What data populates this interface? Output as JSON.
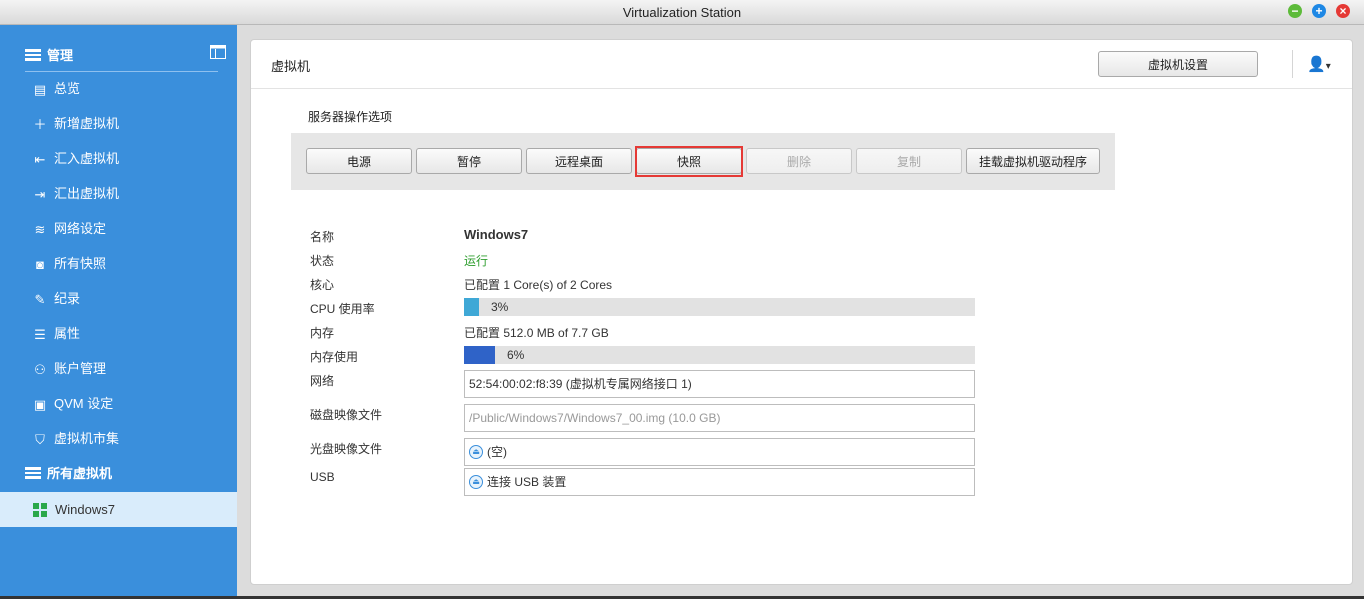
{
  "window": {
    "title": "Virtualization Station"
  },
  "sidebar": {
    "header": "管理",
    "items": [
      {
        "label": "总览",
        "icon": "overview-icon"
      },
      {
        "label": "新增虚拟机",
        "icon": "plus-icon"
      },
      {
        "label": "汇入虚拟机",
        "icon": "import-icon"
      },
      {
        "label": "汇出虚拟机",
        "icon": "export-icon"
      },
      {
        "label": "网络设定",
        "icon": "network-icon"
      },
      {
        "label": "所有快照",
        "icon": "camera-icon"
      },
      {
        "label": "纪录",
        "icon": "log-icon"
      },
      {
        "label": "属性",
        "icon": "list-icon"
      },
      {
        "label": "账户管理",
        "icon": "users-icon"
      },
      {
        "label": "QVM 设定",
        "icon": "settings-icon"
      },
      {
        "label": "虚拟机市集",
        "icon": "market-icon"
      }
    ],
    "section": "所有虚拟机",
    "vm": "Windows7"
  },
  "panel": {
    "title": "虚拟机",
    "settings_button": "虚拟机设置",
    "ops_title": "服务器操作选项",
    "buttons": [
      {
        "label": "电源",
        "enabled": true
      },
      {
        "label": "暂停",
        "enabled": true
      },
      {
        "label": "远程桌面",
        "enabled": true
      },
      {
        "label": "快照",
        "enabled": true
      },
      {
        "label": "删除",
        "enabled": false
      },
      {
        "label": "复制",
        "enabled": false
      },
      {
        "label": "挂载虚拟机驱动程序",
        "enabled": true
      }
    ]
  },
  "details": {
    "name_label": "名称",
    "name": "Windows7",
    "status_label": "状态",
    "status": "运行",
    "core_label": "核心",
    "core": "已配置 1 Core(s) of 2 Cores",
    "cpu_label": "CPU 使用率",
    "cpu_pct_text": "3%",
    "cpu_fraction": 0.03,
    "mem_label": "内存",
    "mem": "已配置 512.0 MB of 7.7 GB",
    "mem_use_label": "内存使用",
    "mem_pct_text": "6%",
    "mem_fraction": 0.06,
    "net_label": "网络",
    "net": "52:54:00:02:f8:39 (虚拟机专属网络接口 1)",
    "disk_label": "磁盘映像文件",
    "disk": "/Public/Windows7/Windows7_00.img (10.0 GB)",
    "cd_label": "光盘映像文件",
    "cd": "(空)",
    "usb_label": "USB",
    "usb": "连接 USB 装置"
  },
  "colors": {
    "sidebar": "#3a8fdc",
    "status_running": "#2e9e2e",
    "cpu_bar": "#3fa8d6",
    "mem_bar": "#2f63c8",
    "highlight": "#e53935"
  }
}
